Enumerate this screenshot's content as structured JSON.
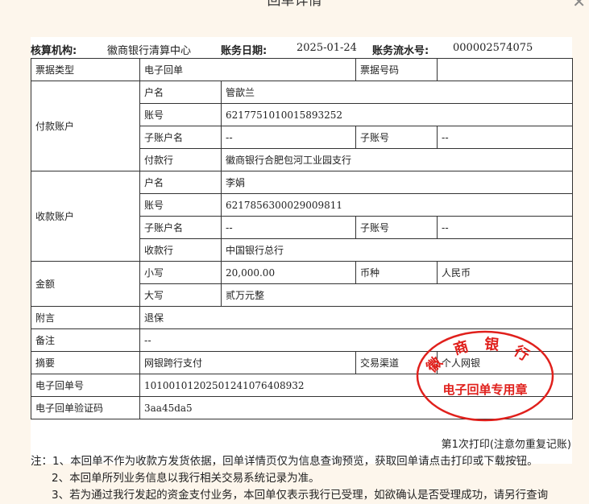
{
  "window": {
    "title": "回单详情",
    "close": "✕"
  },
  "header": {
    "org_label": "核算机构:",
    "org_value": "徽商银行清算中心",
    "date_label": "账务日期:",
    "date_value": "2025-01-24",
    "serial_label": "账务流水号:",
    "serial_value": "000002574075"
  },
  "table": {
    "type_label": "票据类型",
    "type_value": "电子回单",
    "no_label": "票据号码",
    "no_value": "",
    "payer": {
      "section": "付款账户",
      "name_label": "户名",
      "name": "管歆兰",
      "acct_label": "账号",
      "acct": "6217751010015893252",
      "sub_name_label": "子账户名",
      "sub_name": "--",
      "sub_no_label": "子账号",
      "sub_no": "--",
      "bank_label": "付款行",
      "bank": "徽商银行合肥包河工业园支行"
    },
    "payee": {
      "section": "收款账户",
      "name_label": "户名",
      "name": "李娟",
      "acct_label": "账号",
      "acct": "6217856300029009811",
      "sub_name_label": "子账户名",
      "sub_name": "--",
      "sub_no_label": "子账号",
      "sub_no": "--",
      "bank_label": "收款行",
      "bank": "中国银行总行"
    },
    "amount": {
      "section": "金额",
      "small_label": "小写",
      "small": "20,000.00",
      "currency_label": "币种",
      "currency": "人民币",
      "big_label": "大写",
      "big": "贰万元整"
    },
    "memo_label": "附言",
    "memo": "退保",
    "remark_label": "备注",
    "remark": "--",
    "summary_label": "摘要",
    "summary": "网银跨行支付",
    "channel_label": "交易渠道",
    "channel": "个人网银",
    "receipt_no_label": "电子回单号",
    "receipt_no": "101001012025012410764089​32",
    "verify_label": "电子回单验证码",
    "verify": "3aa45da5"
  },
  "stamp": {
    "bank": "徽 商 银 行",
    "purpose": "电子回单专用章",
    "color": "#e0201c"
  },
  "print_info": "第1次打印(注意勿重复记账)",
  "notes": [
    "注：1、本回单不作为收款方发货依据，回单详情页仅为信息查询预览，获取回单请点击打印或下载按钮。",
    "2、本回单所列业务信息以我行相关交易系统记录为准。",
    "3、若为通过我行发起的资金支付业务，本回单仅表示我行已受理，如欲确认是否受理成功，请另行查询"
  ]
}
